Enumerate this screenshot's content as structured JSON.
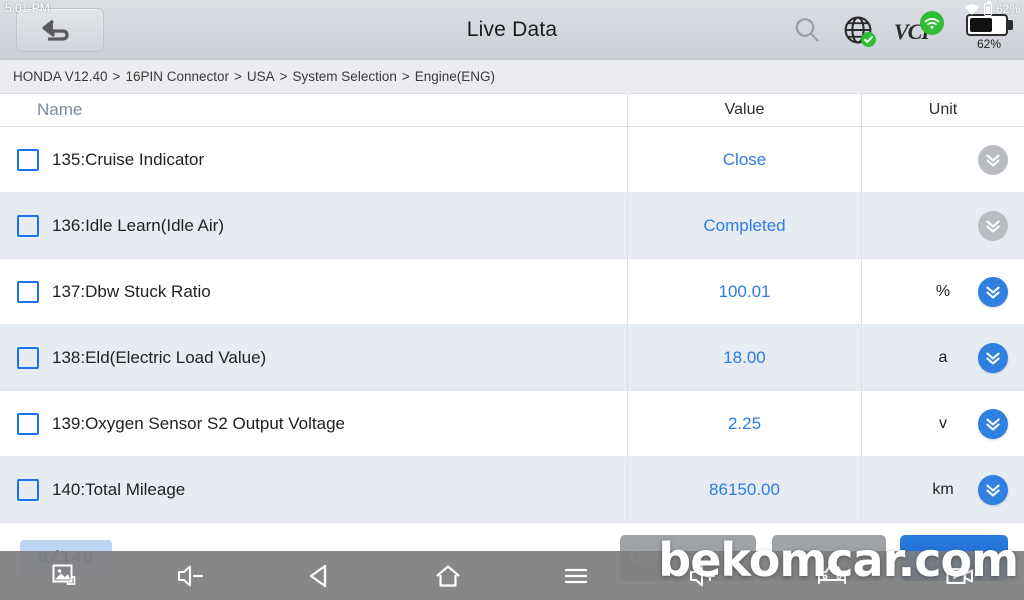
{
  "system_bar": {
    "time": "5:01 PM",
    "battery_percent": "62%",
    "wifi_icon": "wifi-icon",
    "battery_icon": "battery-icon"
  },
  "appbar": {
    "title": "Live Data",
    "back_icon": "back-arrow-icon",
    "search_icon": "search-icon",
    "globe_icon": "globe-icon",
    "globe_badge_icon": "check-badge-icon",
    "vci_label": "VCI",
    "vci_signal_icon": "wifi-signal-icon",
    "battery_percent": "62%"
  },
  "breadcrumb": {
    "separator": ">",
    "segments": [
      "HONDA V12.40",
      "16PIN Connector",
      "USA",
      "System Selection",
      "Engine(ENG)"
    ]
  },
  "table": {
    "columns": [
      "Name",
      "Value",
      "Unit"
    ],
    "expand_icon": "chevron-double-down-icon",
    "rows": [
      {
        "name": "135:Cruise Indicator",
        "value": "Close",
        "unit": "",
        "checked": false,
        "expand_enabled": false
      },
      {
        "name": "136:Idle Learn(Idle Air)",
        "value": "Completed",
        "unit": "",
        "checked": false,
        "expand_enabled": false
      },
      {
        "name": "137:Dbw Stuck Ratio",
        "value": "100.01",
        "unit": "%",
        "checked": false,
        "expand_enabled": true
      },
      {
        "name": "138:Eld(Electric Load Value)",
        "value": "18.00",
        "unit": "a",
        "checked": false,
        "expand_enabled": true
      },
      {
        "name": "139:Oxygen Sensor S2 Output Voltage",
        "value": "2.25",
        "unit": "v",
        "checked": false,
        "expand_enabled": true
      },
      {
        "name": "140:Total Mileage",
        "value": "86150.00",
        "unit": "km",
        "checked": false,
        "expand_enabled": true
      }
    ]
  },
  "counter": {
    "selected": "0",
    "separator": "/",
    "total": "140"
  },
  "footer": {
    "cancel_label": "Cancel Selected",
    "middle_label": "",
    "record_label": ""
  },
  "navbar": {
    "items": [
      {
        "name": "screenshot-icon",
        "label": ""
      },
      {
        "name": "volume-down-icon",
        "label": ""
      },
      {
        "name": "back-triangle-icon",
        "label": ""
      },
      {
        "name": "home-icon",
        "label": ""
      },
      {
        "name": "menu-icon",
        "label": ""
      },
      {
        "name": "volume-up-icon",
        "label": ""
      },
      {
        "name": "car-icon",
        "label": ""
      },
      {
        "name": "screen-record-icon",
        "label": ""
      }
    ]
  },
  "watermark": {
    "text": "bekomcar.com"
  },
  "colors": {
    "accent_blue": "#2f7de1",
    "checkbox_blue": "#1a73e8",
    "row_alt": "#e7ebf2",
    "breadcrumb_bg": "#eaecef",
    "appbar_bg": "#d3d7dd",
    "status_green": "#2ebd34",
    "chevron_disabled": "#b9bcc0",
    "navbar_bg": "#7e7e7e"
  }
}
